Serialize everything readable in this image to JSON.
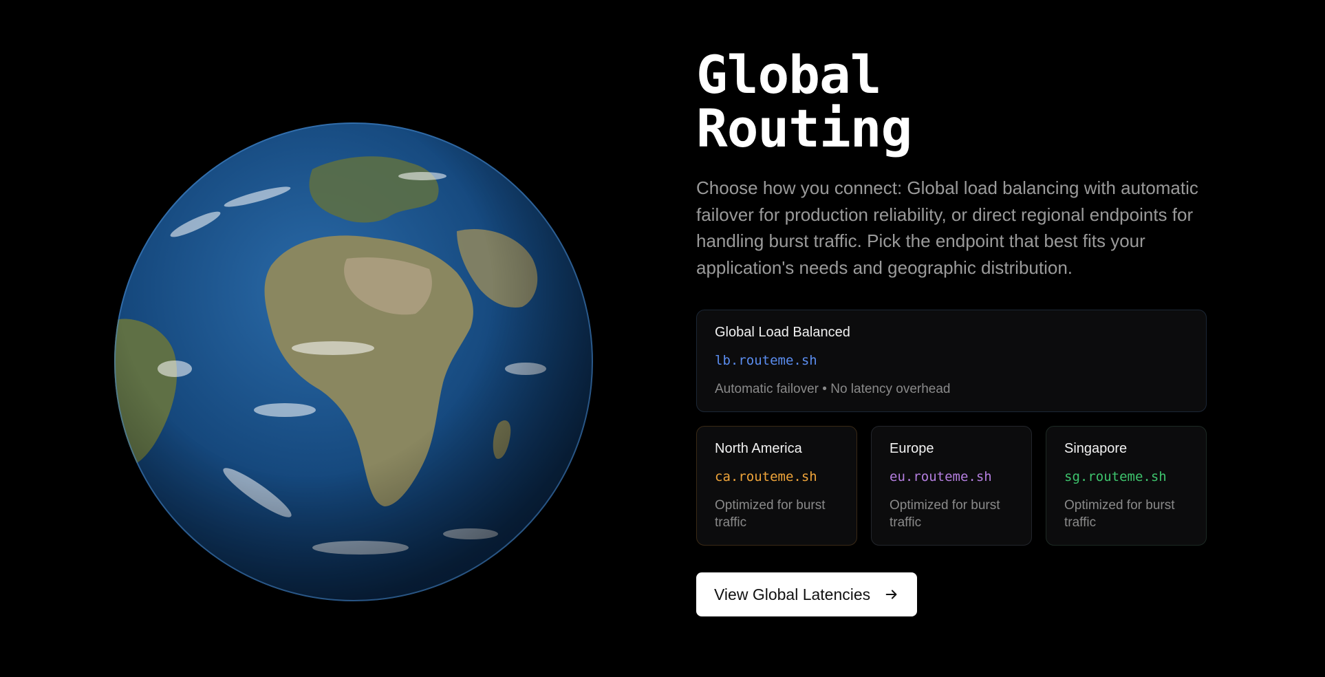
{
  "hero": {
    "title_line1": "Global",
    "title_line2": "Routing",
    "description": "Choose how you connect: Global load balancing with automatic failover for production reliability, or direct regional endpoints for handling burst traffic. Pick the endpoint that best fits your application's needs and geographic distribution."
  },
  "load_balanced": {
    "title": "Global Load Balanced",
    "host": "lb.routeme.sh",
    "note": "Automatic failover • No latency overhead",
    "accent": "#5b8def"
  },
  "regions": [
    {
      "title": "North America",
      "host": "ca.routeme.sh",
      "note": "Optimized for burst traffic",
      "accent": "#f0a53a",
      "border": "#3a2a16"
    },
    {
      "title": "Europe",
      "host": "eu.routeme.sh",
      "note": "Optimized for burst traffic",
      "accent": "#b57fe0",
      "border": "#23262c"
    },
    {
      "title": "Singapore",
      "host": "sg.routeme.sh",
      "note": "Optimized for burst traffic",
      "accent": "#3ec46d",
      "border": "#1d2a24"
    }
  ],
  "cta": {
    "label": "View Global Latencies",
    "icon": "arrow-right-icon"
  },
  "globe": {
    "icon": "earth-globe"
  }
}
